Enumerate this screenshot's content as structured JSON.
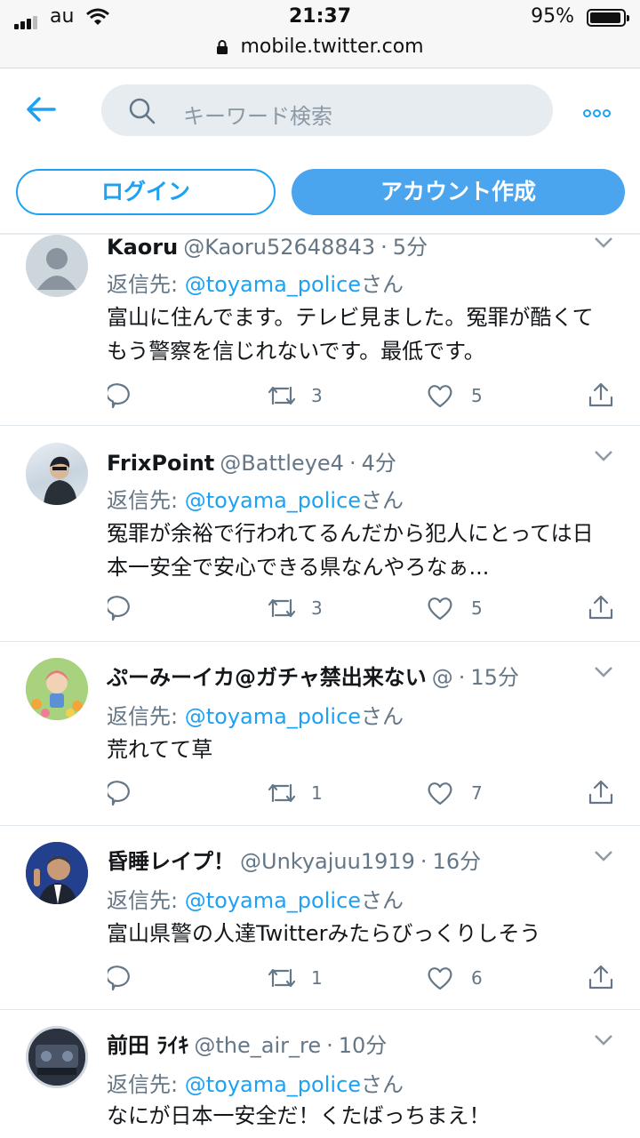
{
  "status_bar": {
    "carrier": "au",
    "time": "21:37",
    "battery": "95%"
  },
  "browser": {
    "url": "mobile.twitter.com"
  },
  "header": {
    "search_placeholder": "キーワード検索",
    "login_label": "ログイン",
    "signup_label": "アカウント作成"
  },
  "colors": {
    "accent": "#1da1f2",
    "muted": "#657786",
    "search_bg": "#e6ecf0"
  },
  "reply_prefix": "返信先: ",
  "reply_suffix": "さん",
  "tweets": [
    {
      "name": "Kaoru",
      "handle": "@Kaoru52648843",
      "time": "5分",
      "reply_to": "@toyama_police",
      "text": "富山に住んでます。テレビ見ました。冤罪が酷くてもう警察を信じれないです。最低です。",
      "retweets": "3",
      "likes": "5"
    },
    {
      "name": "FrixPoint",
      "handle": "@Battleye4",
      "time": "4分",
      "reply_to": "@toyama_police",
      "text": "冤罪が余裕で行われてるんだから犯人にとっては日本一安全で安心できる県なんやろなぁ...",
      "retweets": "3",
      "likes": "5"
    },
    {
      "name": "ぷーみーイカ@ガチャ禁出来ない",
      "handle": "@",
      "time": "15分",
      "reply_to": "@toyama_police",
      "text": "荒れてて草",
      "retweets": "1",
      "likes": "7"
    },
    {
      "name": "昏睡レイプ！",
      "handle": "@Unkyajuu1919",
      "time": "16分",
      "reply_to": "@toyama_police",
      "text": "富山県警の人達Twitterみたらびっくりしそう",
      "retweets": "1",
      "likes": "6"
    },
    {
      "name": "前田 ﾗｲｷ",
      "handle": "@the_air_re",
      "time": "10分",
      "reply_to": "@toyama_police",
      "text": "なにが日本一安全だ！くたばっちまえ！",
      "retweets": "",
      "likes": ""
    }
  ]
}
